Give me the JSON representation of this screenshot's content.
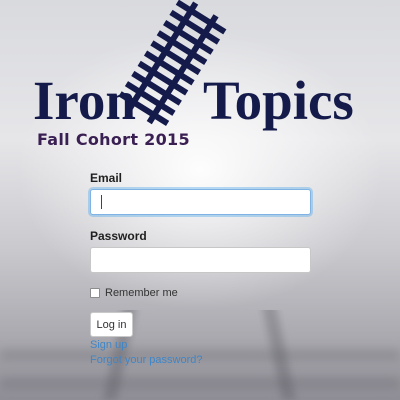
{
  "logo": {
    "word_left": "Iron",
    "word_right": "Topics",
    "subtitle": "Fall Cohort 2015",
    "icon": "railroad-track-icon"
  },
  "form": {
    "email_label": "Email",
    "email_value": "",
    "password_label": "Password",
    "password_value": "",
    "remember_label": "Remember me",
    "remember_checked": false,
    "login_button": "Log in",
    "signup_link": "Sign up",
    "forgot_link": "Forgot your password?"
  },
  "colors": {
    "logo_text": "#141a4a",
    "subtitle_text": "#3a1f52",
    "link": "#3f86c7",
    "focus_ring": "#7fb3e4"
  }
}
